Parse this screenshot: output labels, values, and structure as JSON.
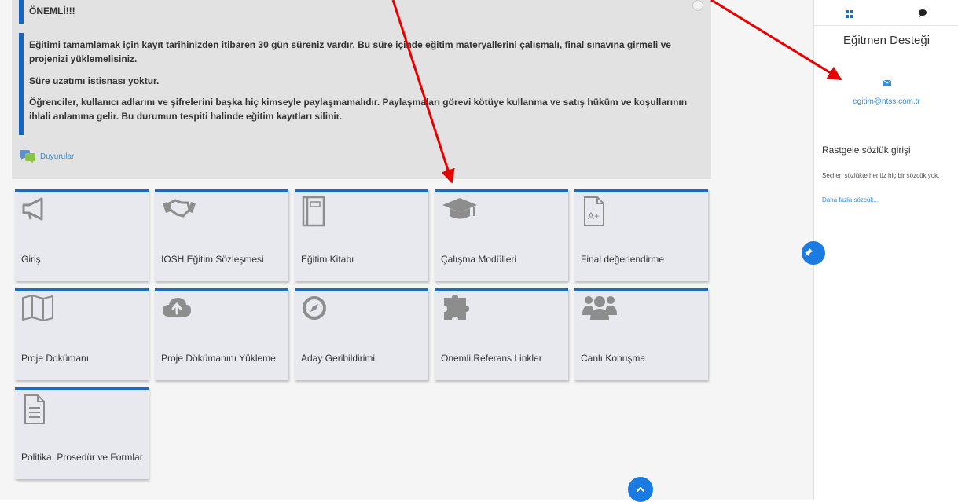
{
  "notice": {
    "heading": "ÖNEMLİ!!!",
    "p1": "Eğitimi tamamlamak için kayıt tarihinizden itibaren 30 gün süreniz vardır. Bu süre içinde eğitim materyallerini çalışmalı, final sınavına girmeli ve projenizi yüklemelisiniz.",
    "p2": "Süre uzatımı istisnası yoktur.",
    "p3": "Öğrenciler, kullanıcı adlarını ve şifrelerini başka hiç kimseyle paylaşmamalıdır. Paylaşmaları görevi kötüye kullanma ve satış hüküm ve koşullarının ihlali anlamına gelir. Bu durumun tespiti halinde eğitim kayıtları silinir.",
    "link": "Duyurular"
  },
  "tiles": [
    {
      "label": "Giriş",
      "icon": "megaphone-icon"
    },
    {
      "label": "IOSH Eğitim Sözleşmesi",
      "icon": "handshake-icon"
    },
    {
      "label": "Eğitim Kitabı",
      "icon": "notebook-icon"
    },
    {
      "label": "Çalışma Modülleri",
      "icon": "graduation-cap-icon"
    },
    {
      "label": "Final değerlendirme",
      "icon": "grade-file-icon"
    },
    {
      "label": "Proje Dokümanı",
      "icon": "map-icon"
    },
    {
      "label": "Proje Dökümanını Yükleme",
      "icon": "cloud-upload-icon"
    },
    {
      "label": "Aday Geribildirimi",
      "icon": "compass-icon"
    },
    {
      "label": "Önemli Referans Linkler",
      "icon": "puzzle-icon"
    },
    {
      "label": "Canlı Konuşma",
      "icon": "users-icon"
    },
    {
      "label": "Politika, Prosedür ve Formlar",
      "icon": "document-icon"
    }
  ],
  "sidebar": {
    "support_title": "Eğitmen Desteği",
    "email": "egitim@ntss.com.tr",
    "glossary_title": "Rastgele sözlük girişi",
    "glossary_empty": "Seçilen sözlükte henüz hiç bir sözcük yok.",
    "glossary_more": "Daha fazla sözcük..."
  },
  "colors": {
    "accent": "#1a6bc4",
    "link": "#3b8ed4",
    "arrow": "#e60000"
  }
}
